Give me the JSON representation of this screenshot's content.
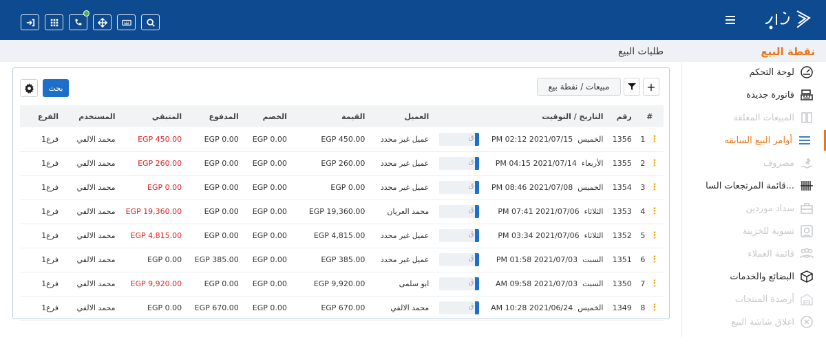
{
  "topbar": {
    "color": "#0e4a8f",
    "icons": [
      "sign-in-icon",
      "grid-icon",
      "phone-icon",
      "move-icon",
      "keyboard-icon",
      "search-icon"
    ]
  },
  "sidebar": {
    "title": "نقطة البيع",
    "items": [
      {
        "label": "لوحة التحكم",
        "icon": "dashboard-icon",
        "state": "normal"
      },
      {
        "label": "فاتورة جديدة",
        "icon": "cash-register-icon",
        "state": "normal"
      },
      {
        "label": "المبيعات المعلقة",
        "icon": "columns-icon",
        "state": "muted"
      },
      {
        "label": "أوامر البيع السابقه",
        "icon": "list-icon",
        "state": "active"
      },
      {
        "label": "مصروف",
        "icon": "hand-money-icon",
        "state": "muted"
      },
      {
        "label": "قائمة المرتجعات السا...",
        "icon": "barcode-icon",
        "state": "normal"
      },
      {
        "label": "سداد موردين",
        "icon": "briefcase-icon",
        "state": "muted"
      },
      {
        "label": "تسوية للخزينة",
        "icon": "safe-icon",
        "state": "muted"
      },
      {
        "label": "قائمة العملاء",
        "icon": "users-icon",
        "state": "muted"
      },
      {
        "label": "البضائع والخدمات",
        "icon": "box-icon",
        "state": "normal"
      },
      {
        "label": "أرصدة المنتجات",
        "icon": "warehouse-icon",
        "state": "muted"
      },
      {
        "label": "اغلاق شاشة البيع",
        "icon": "close-circle-icon",
        "state": "muted"
      }
    ]
  },
  "page": {
    "title": "طلبات البيع"
  },
  "toolbar": {
    "breadcrumb": "مبيعات / نقطة بيع",
    "search_label": "بحث"
  },
  "table": {
    "headers": {
      "idx": "#",
      "no": "رقم",
      "date": "التاريخ / التوقيت",
      "customer": "العميل",
      "value": "القيمة",
      "discount": "الخصم",
      "paid": "المدفوع",
      "remaining": "المتبقي",
      "user": "المستخدم",
      "branch": "الفرع"
    },
    "tag_letter": "ق",
    "rows": [
      {
        "idx": "1",
        "no": "1356",
        "day": "الخميس",
        "datetime": "PM 02:12 2021/07/15",
        "customer": "عميل غير محدد",
        "value": "EGP 450.00",
        "discount": "EGP 0.00",
        "paid": "EGP 0.00",
        "remaining": "EGP 450.00",
        "remaining_red": true,
        "user": "محمد الالفي",
        "branch": "فرع1"
      },
      {
        "idx": "2",
        "no": "1355",
        "day": "الأربعاء",
        "datetime": "PM 04:15 2021/07/14",
        "customer": "عميل غير محدد",
        "value": "EGP 260.00",
        "discount": "EGP 0.00",
        "paid": "EGP 0.00",
        "remaining": "EGP 260.00",
        "remaining_red": true,
        "user": "محمد الالفي",
        "branch": "فرع1"
      },
      {
        "idx": "3",
        "no": "1354",
        "day": "الخميس",
        "datetime": "PM 08:46 2021/07/08",
        "customer": "عميل غير محدد",
        "value": "EGP 0.00",
        "discount": "EGP 0.00",
        "paid": "EGP 0.00",
        "remaining": "EGP 0.00",
        "remaining_red": true,
        "user": "محمد الالفي",
        "branch": "فرع1"
      },
      {
        "idx": "4",
        "no": "1353",
        "day": "الثلاثاء",
        "datetime": "PM 07:41 2021/07/06",
        "customer": "محمد العريان",
        "value": "EGP 19,360.00",
        "discount": "EGP 0.00",
        "paid": "EGP 0.00",
        "remaining": "EGP 19,360.00",
        "remaining_red": true,
        "user": "محمد الالفي",
        "branch": "فرع1"
      },
      {
        "idx": "5",
        "no": "1352",
        "day": "الثلاثاء",
        "datetime": "PM 03:34 2021/07/06",
        "customer": "عميل غير محدد",
        "value": "EGP 4,815.00",
        "discount": "EGP 0.00",
        "paid": "EGP 0.00",
        "remaining": "EGP 4,815.00",
        "remaining_red": true,
        "user": "محمد الالفي",
        "branch": "فرع1"
      },
      {
        "idx": "6",
        "no": "1351",
        "day": "السبت",
        "datetime": "PM 01:58 2021/07/03",
        "customer": "عميل غير محدد",
        "value": "EGP 385.00",
        "discount": "EGP 0.00",
        "paid": "EGP 385.00",
        "remaining": "EGP 0.00",
        "remaining_red": false,
        "user": "محمد الالفي",
        "branch": "فرع1"
      },
      {
        "idx": "7",
        "no": "1350",
        "day": "السبت",
        "datetime": "AM 09:58 2021/07/03",
        "customer": "ابو سلمى",
        "value": "EGP 9,920.00",
        "discount": "EGP 0.00",
        "paid": "EGP 0.00",
        "remaining": "EGP 9,920.00",
        "remaining_red": true,
        "user": "محمد الالفي",
        "branch": "فرع1"
      },
      {
        "idx": "8",
        "no": "1349",
        "day": "الخميس",
        "datetime": "AM 10:28 2021/06/24",
        "customer": "محمد الالفي",
        "value": "EGP 670.00",
        "discount": "EGP 0.00",
        "paid": "EGP 670.00",
        "remaining": "EGP 0.00",
        "remaining_red": false,
        "user": "محمد الالفي",
        "branch": "فرع1"
      }
    ]
  },
  "colors": {
    "accent_orange": "#e8761b",
    "primary_blue": "#1e6fc9",
    "danger_red": "#e02020"
  }
}
